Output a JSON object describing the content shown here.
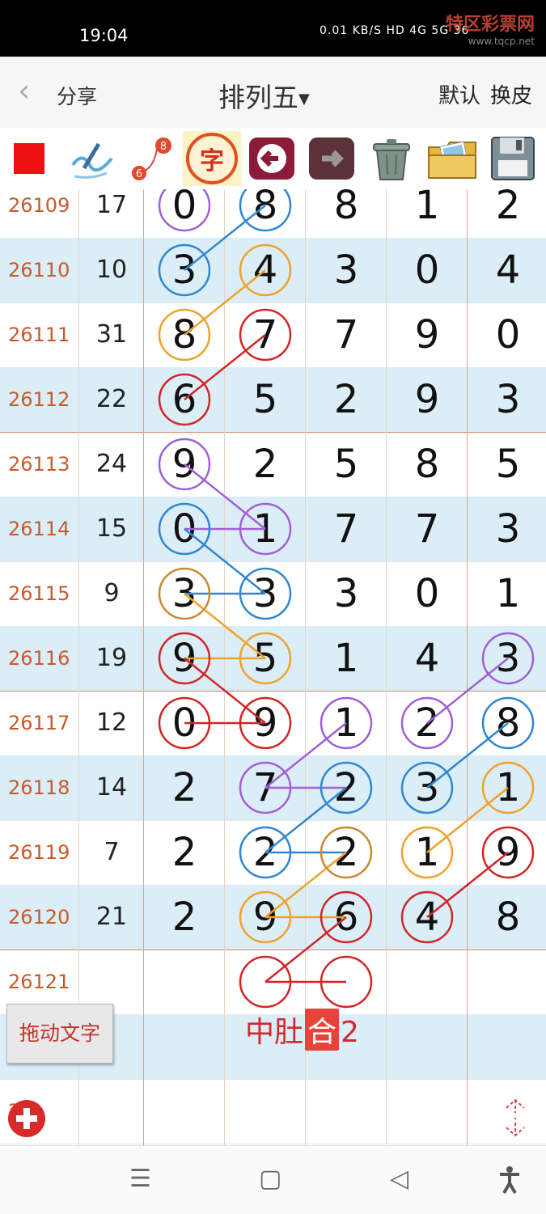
{
  "status_bar": {
    "time": "19:04",
    "indicators": "0.01 KB/S HD 4G 5G 36",
    "watermark": "特区彩票网",
    "watermark_url": "www.tqcp.net"
  },
  "header": {
    "back_icon": "chevron-left-icon",
    "share_label": "分享",
    "title": "排列五",
    "title_dropdown_icon": "triangle-down-icon",
    "default_label": "默认",
    "skin_label": "换皮"
  },
  "toolbar": {
    "tools": [
      {
        "name": "red-square-icon"
      },
      {
        "name": "pen-curve-icon"
      },
      {
        "name": "link-6-8-icon",
        "text_a": "6",
        "text_b": "8"
      },
      {
        "name": "text-char-icon",
        "text": "字"
      },
      {
        "name": "undo-arrow-icon"
      },
      {
        "name": "redo-arrow-icon"
      },
      {
        "name": "trash-can-icon"
      },
      {
        "name": "photo-folder-icon"
      },
      {
        "name": "floppy-save-icon"
      }
    ]
  },
  "rows": [
    {
      "issue": "26109",
      "sum": "17",
      "digits": [
        "0",
        "8",
        "8",
        "1",
        "2"
      ]
    },
    {
      "issue": "26110",
      "sum": "10",
      "digits": [
        "3",
        "4",
        "3",
        "0",
        "4"
      ]
    },
    {
      "issue": "26111",
      "sum": "31",
      "digits": [
        "8",
        "7",
        "7",
        "9",
        "0"
      ]
    },
    {
      "issue": "26112",
      "sum": "22",
      "digits": [
        "6",
        "5",
        "2",
        "9",
        "3"
      ]
    },
    {
      "issue": "26113",
      "sum": "24",
      "digits": [
        "9",
        "2",
        "5",
        "8",
        "5"
      ]
    },
    {
      "issue": "26114",
      "sum": "15",
      "digits": [
        "0",
        "1",
        "7",
        "7",
        "3"
      ]
    },
    {
      "issue": "26115",
      "sum": "9",
      "digits": [
        "3",
        "3",
        "3",
        "0",
        "1"
      ]
    },
    {
      "issue": "26116",
      "sum": "19",
      "digits": [
        "9",
        "5",
        "1",
        "4",
        "3"
      ]
    },
    {
      "issue": "26117",
      "sum": "12",
      "digits": [
        "0",
        "9",
        "1",
        "2",
        "8"
      ]
    },
    {
      "issue": "26118",
      "sum": "14",
      "digits": [
        "2",
        "7",
        "2",
        "3",
        "1"
      ]
    },
    {
      "issue": "26119",
      "sum": "7",
      "digits": [
        "2",
        "2",
        "2",
        "1",
        "9"
      ]
    },
    {
      "issue": "26120",
      "sum": "21",
      "digits": [
        "2",
        "9",
        "6",
        "4",
        "8"
      ]
    },
    {
      "issue": "26121",
      "sum": "",
      "digits": [
        "",
        "",
        "",
        "",
        ""
      ]
    },
    {
      "issue": "",
      "sum": "",
      "digits": [
        "",
        "",
        "",
        "",
        ""
      ]
    },
    {
      "issue": "23",
      "sum": "",
      "digits": [
        "",
        "",
        "",
        "",
        ""
      ]
    }
  ],
  "colors": {
    "purple": "#a05fd6",
    "blue": "#2f86d1",
    "orange": "#efa12c",
    "red": "#d22525",
    "brown": "#c98a2e",
    "issue_text": "#c85a2a"
  },
  "marks": [
    {
      "row": 0,
      "col": 0,
      "color": "purple"
    },
    {
      "row": 0,
      "col": 1,
      "color": "blue"
    },
    {
      "row": 1,
      "col": 0,
      "color": "blue"
    },
    {
      "row": 1,
      "col": 1,
      "color": "orange"
    },
    {
      "row": 2,
      "col": 0,
      "color": "orange"
    },
    {
      "row": 2,
      "col": 1,
      "color": "red"
    },
    {
      "row": 3,
      "col": 0,
      "color": "red"
    },
    {
      "row": 4,
      "col": 0,
      "color": "purple"
    },
    {
      "row": 5,
      "col": 0,
      "color": "blue"
    },
    {
      "row": 5,
      "col": 1,
      "color": "purple"
    },
    {
      "row": 6,
      "col": 0,
      "color": "brown"
    },
    {
      "row": 6,
      "col": 1,
      "color": "blue"
    },
    {
      "row": 7,
      "col": 0,
      "color": "red"
    },
    {
      "row": 7,
      "col": 1,
      "color": "orange"
    },
    {
      "row": 7,
      "col": 4,
      "color": "purple"
    },
    {
      "row": 8,
      "col": 0,
      "color": "red"
    },
    {
      "row": 8,
      "col": 1,
      "color": "red"
    },
    {
      "row": 8,
      "col": 2,
      "color": "purple"
    },
    {
      "row": 8,
      "col": 3,
      "color": "purple"
    },
    {
      "row": 8,
      "col": 4,
      "color": "blue"
    },
    {
      "row": 9,
      "col": 1,
      "color": "purple"
    },
    {
      "row": 9,
      "col": 2,
      "color": "blue"
    },
    {
      "row": 9,
      "col": 3,
      "color": "blue"
    },
    {
      "row": 9,
      "col": 4,
      "color": "orange"
    },
    {
      "row": 10,
      "col": 1,
      "color": "blue"
    },
    {
      "row": 10,
      "col": 2,
      "color": "brown"
    },
    {
      "row": 10,
      "col": 3,
      "color": "orange"
    },
    {
      "row": 10,
      "col": 4,
      "color": "red"
    },
    {
      "row": 11,
      "col": 1,
      "color": "orange"
    },
    {
      "row": 11,
      "col": 2,
      "color": "red"
    },
    {
      "row": 11,
      "col": 3,
      "color": "red"
    },
    {
      "row": 12,
      "col": 1,
      "color": "red"
    },
    {
      "row": 12,
      "col": 2,
      "color": "red"
    }
  ],
  "links": [
    {
      "from": [
        0,
        1
      ],
      "to": [
        1,
        0
      ],
      "color": "blue"
    },
    {
      "from": [
        1,
        1
      ],
      "to": [
        2,
        0
      ],
      "color": "orange"
    },
    {
      "from": [
        2,
        1
      ],
      "to": [
        3,
        0
      ],
      "color": "red"
    },
    {
      "from": [
        4,
        0
      ],
      "to": [
        5,
        1
      ],
      "color": "purple"
    },
    {
      "from": [
        5,
        0
      ],
      "to": [
        5,
        1
      ],
      "color": "purple"
    },
    {
      "from": [
        5,
        0
      ],
      "to": [
        6,
        1
      ],
      "color": "blue"
    },
    {
      "from": [
        6,
        0
      ],
      "to": [
        6,
        1
      ],
      "color": "blue"
    },
    {
      "from": [
        6,
        0
      ],
      "to": [
        7,
        1
      ],
      "color": "orange"
    },
    {
      "from": [
        7,
        0
      ],
      "to": [
        7,
        1
      ],
      "color": "orange"
    },
    {
      "from": [
        7,
        0
      ],
      "to": [
        8,
        1
      ],
      "color": "red"
    },
    {
      "from": [
        8,
        0
      ],
      "to": [
        8,
        1
      ],
      "color": "red"
    },
    {
      "from": [
        8,
        2
      ],
      "to": [
        9,
        1
      ],
      "color": "purple"
    },
    {
      "from": [
        9,
        1
      ],
      "to": [
        9,
        2
      ],
      "color": "purple"
    },
    {
      "from": [
        7,
        4
      ],
      "to": [
        8,
        3
      ],
      "color": "purple"
    },
    {
      "from": [
        9,
        2
      ],
      "to": [
        10,
        1
      ],
      "color": "blue"
    },
    {
      "from": [
        10,
        1
      ],
      "to": [
        10,
        2
      ],
      "color": "blue"
    },
    {
      "from": [
        8,
        4
      ],
      "to": [
        9,
        3
      ],
      "color": "blue"
    },
    {
      "from": [
        10,
        2
      ],
      "to": [
        11,
        1
      ],
      "color": "orange"
    },
    {
      "from": [
        11,
        1
      ],
      "to": [
        11,
        2
      ],
      "color": "orange"
    },
    {
      "from": [
        9,
        4
      ],
      "to": [
        10,
        3
      ],
      "color": "orange"
    },
    {
      "from": [
        11,
        2
      ],
      "to": [
        12,
        1
      ],
      "color": "red"
    },
    {
      "from": [
        12,
        1
      ],
      "to": [
        12,
        2
      ],
      "color": "red"
    },
    {
      "from": [
        10,
        4
      ],
      "to": [
        11,
        3
      ],
      "color": "red"
    }
  ],
  "drag_text_label": "拖动文字",
  "annotation": {
    "part1": "中肚",
    "box": "合",
    "part2": "2"
  },
  "add_button_icon": "plus-circle-icon",
  "scroll_icon": "up-down-arrows-icon",
  "nav": {
    "menu": "☰",
    "home": "▢",
    "back": "◁",
    "accessibility": "accessibility-icon"
  }
}
